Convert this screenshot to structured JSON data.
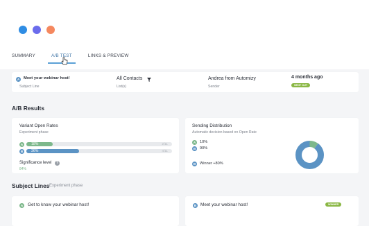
{
  "window": {
    "dots": [
      {
        "name": "window-dot-blue",
        "color": "#2f8de4"
      },
      {
        "name": "window-dot-purple",
        "color": "#6b6cec"
      },
      {
        "name": "window-dot-orange",
        "color": "#f5885f"
      }
    ]
  },
  "tabs": [
    {
      "label": "SUMMARY",
      "active": false
    },
    {
      "label": "A/B TEST",
      "active": true
    },
    {
      "label": "LINKS & PREVIEW",
      "active": false
    }
  ],
  "overview": {
    "badge_letter": "A",
    "subject": "Meet your webinar host!",
    "subject_caption": "Subject Line",
    "list": "All Contacts",
    "list_caption": "List(s)",
    "filter_icon": "filter-icon",
    "sender": "Andrea from Automizy",
    "sender_caption": "Sender",
    "time": "4 months ago",
    "status": "SENT OUT"
  },
  "ab_results": {
    "title": "A/B Results",
    "open_rates": {
      "title": "Variant Open Rates",
      "subtitle": "Experiment phase",
      "variants": [
        {
          "letter": "A",
          "percent_label": "18%",
          "value": 18,
          "count": "2/11",
          "color": "#7db88b"
        },
        {
          "letter": "B",
          "percent_label": "36%",
          "value": 36,
          "count": "4/11",
          "color": "#5b93c4"
        }
      ],
      "significance_label": "Significance level",
      "significance_value": "84%",
      "help_icon": "help-icon"
    },
    "distribution": {
      "title": "Sending Distribution",
      "subtitle": "Automatic decision based on Open Rate",
      "items": [
        {
          "letter": "A",
          "label": "10%",
          "value": 10,
          "color": "#7db88b"
        },
        {
          "letter": "B",
          "label": "90%",
          "value": 90,
          "color": "#5b93c4"
        }
      ],
      "winner_letter": "B",
      "winner_label": "Winner +80%"
    }
  },
  "subject_lines": {
    "title": "Subject Lines",
    "phase": "Experiment phase",
    "items": [
      {
        "letter": "A",
        "text": "Get to know your webinar host!"
      },
      {
        "letter": "B",
        "text": "Meet your webinar host!",
        "badge": "WINNER"
      }
    ]
  }
}
